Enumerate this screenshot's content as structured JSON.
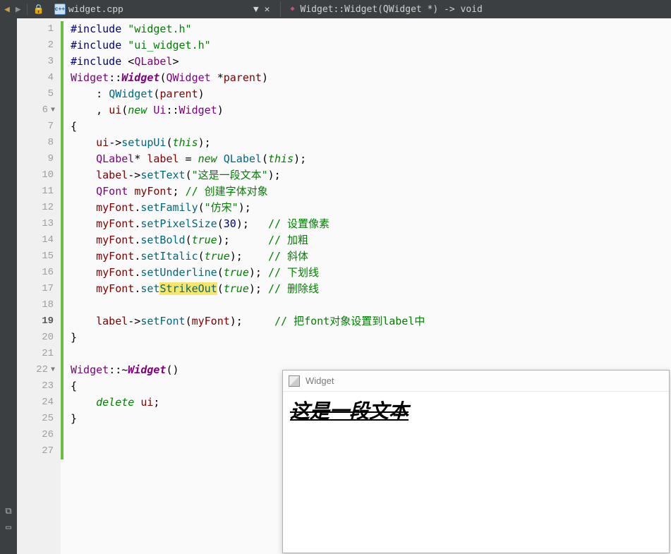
{
  "toolbar": {
    "file_name": "widget.cpp",
    "modified_glyph": "▼",
    "close_glyph": "✕",
    "breadcrumb": "Widget::Widget(QWidget *) -> void"
  },
  "gutter": {
    "lines": [
      "1",
      "2",
      "3",
      "4",
      "5",
      "6",
      "7",
      "8",
      "9",
      "10",
      "11",
      "12",
      "13",
      "14",
      "15",
      "16",
      "17",
      "18",
      "19",
      "20",
      "21",
      "22",
      "23",
      "24",
      "25",
      "26",
      "27"
    ],
    "fold_at": [
      6,
      22
    ],
    "current": 19
  },
  "code": {
    "l1": {
      "pp": "#include ",
      "s": "\"widget.h\""
    },
    "l2": {
      "pp": "#include ",
      "s": "\"ui_widget.h\""
    },
    "l3": {
      "pp": "#include ",
      "a1": "<",
      "t": "QLabel",
      "a2": ">"
    },
    "l4": {
      "t1": "Widget",
      "cc": "::",
      "fn": "Widget",
      "p1": "(",
      "t2": "QWidget",
      "sp": " *",
      "id": "parent",
      "p2": ")"
    },
    "l5": {
      "txt": "    : ",
      "fn": "QWidget",
      "p1": "(",
      "id": "parent",
      "p2": ")"
    },
    "l6": {
      "txt": "    , ",
      "id": "ui",
      "p1": "(",
      "kw": "new",
      "sp": " ",
      "t": "Ui",
      "cc": "::",
      "t2": "Widget",
      "p2": ")"
    },
    "l7": {
      "b": "{"
    },
    "l8": {
      "ind": "    ",
      "id": "ui",
      "ar": "->",
      "fn": "setupUi",
      "p1": "(",
      "kw": "this",
      "p2": ");"
    },
    "l9": {
      "ind": "    ",
      "t": "QLabel",
      "st": "* ",
      "id": "label",
      "eq": " = ",
      "kw": "new",
      "sp": " ",
      "fn": "QLabel",
      "p1": "(",
      "kw2": "this",
      "p2": ");"
    },
    "l10": {
      "ind": "    ",
      "id": "label",
      "ar": "->",
      "fn": "setText",
      "p1": "(",
      "s": "\"这是一段文本\"",
      "p2": ");"
    },
    "l11": {
      "ind": "    ",
      "t": "QFont",
      "sp": " ",
      "id": "myFont",
      "sc": "; ",
      "cmt": "// 创建字体对象"
    },
    "l12": {
      "ind": "    ",
      "id": "myFont",
      "dot": ".",
      "fn": "setFamily",
      "p1": "(",
      "s": "\"仿宋\"",
      "p2": ");"
    },
    "l13": {
      "ind": "    ",
      "id": "myFont",
      "dot": ".",
      "fn": "setPixelSize",
      "p1": "(",
      "n": "30",
      "p2": ");",
      "pad": "   ",
      "cmt": "// 设置像素"
    },
    "l14": {
      "ind": "    ",
      "id": "myFont",
      "dot": ".",
      "fn": "setBold",
      "p1": "(",
      "kw": "true",
      "p2": ");",
      "pad": "      ",
      "cmt": "// 加粗"
    },
    "l15": {
      "ind": "    ",
      "id": "myFont",
      "dot": ".",
      "fn": "setItalic",
      "p1": "(",
      "kw": "true",
      "p2": ");",
      "pad": "    ",
      "cmt": "// 斜体"
    },
    "l16": {
      "ind": "    ",
      "id": "myFont",
      "dot": ".",
      "fn": "setUnderline",
      "p1": "(",
      "kw": "true",
      "p2": ");",
      "pad": " ",
      "cmt": "// 下划线"
    },
    "l17": {
      "ind": "    ",
      "id": "myFont",
      "dot": ".",
      "fn1": "set",
      "hl": "StrikeOut",
      "p1": "(",
      "kw": "true",
      "p2": ");",
      "pad": " ",
      "cmt": "// 删除线"
    },
    "l18": {
      "blank": ""
    },
    "l19": {
      "ind": "    ",
      "id": "label",
      "ar": "->",
      "fn": "setFont",
      "p1": "(",
      "id2": "myFont",
      "p2": ");",
      "pad": "     ",
      "cmt": "// 把font对象设置到label中"
    },
    "l20": {
      "b": "}"
    },
    "l21": {
      "blank": ""
    },
    "l22": {
      "t": "Widget",
      "cc": "::~",
      "fn": "Widget",
      "p": "()"
    },
    "l23": {
      "b": "{"
    },
    "l24": {
      "ind": "    ",
      "kw": "delete",
      "sp": " ",
      "id": "ui",
      "sc": ";"
    },
    "l25": {
      "b": "}"
    },
    "l26": {
      "blank": ""
    },
    "l27": {
      "blank": ""
    }
  },
  "preview": {
    "title": "Widget",
    "text": "这是一段文本"
  },
  "sidebar": {
    "panel_glyph": "⧉",
    "settings_glyph": "⚙"
  }
}
